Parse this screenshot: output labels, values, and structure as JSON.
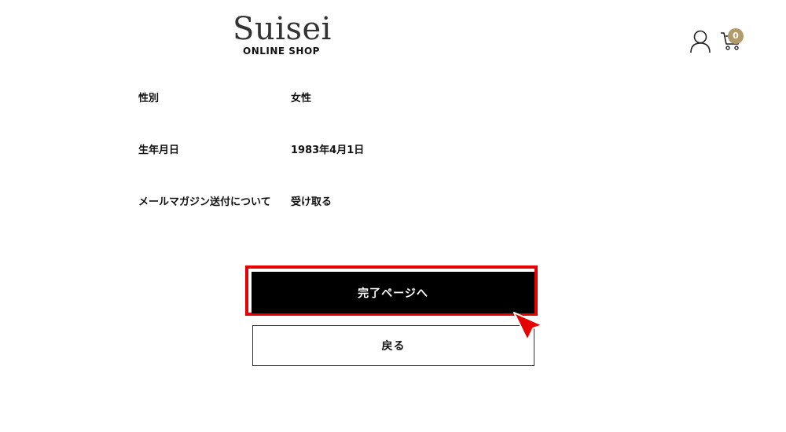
{
  "header": {
    "logo_brand": "Suisei",
    "logo_sub": "ONLINE SHOP",
    "cart_count": "0",
    "user_icon": "user-icon",
    "cart_icon": "cart-icon"
  },
  "rows": [
    {
      "label": "性別",
      "value": "女性"
    },
    {
      "label": "生年月日",
      "value": "1983年4月1日"
    },
    {
      "label": "メールマガジン送付について",
      "value": "受け取る"
    }
  ],
  "actions": {
    "primary_label": "完了ページへ",
    "back_label": "戻る"
  },
  "colors": {
    "badge": "#b39a6b",
    "primary_bg": "#000000",
    "highlight": "#e60000"
  }
}
